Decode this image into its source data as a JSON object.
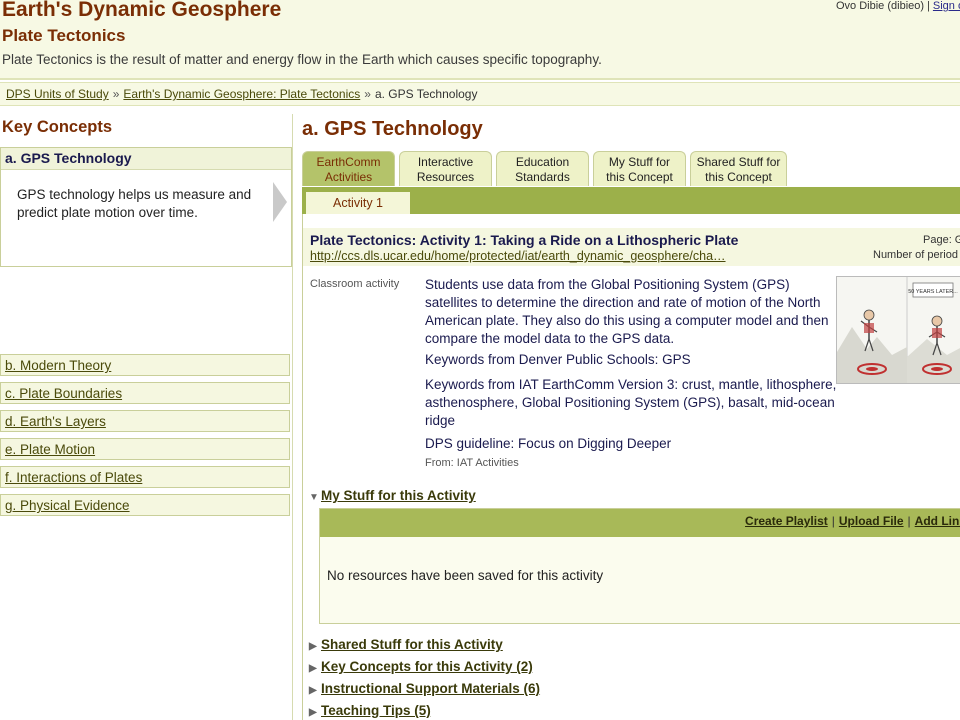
{
  "header": {
    "title": "Earth's Dynamic Geosphere",
    "subtitle": "Plate Tectonics",
    "description": "Plate Tectonics is the result of matter and energy flow in the Earth which causes specific topography.",
    "user": "Ovo Dibie (dibieo)",
    "signout": "Sign o"
  },
  "breadcrumb": {
    "items": [
      "DPS Units of Study",
      "Earth's Dynamic Geosphere: Plate Tectonics"
    ],
    "current": "a. GPS Technology",
    "separator": "»"
  },
  "sidebar": {
    "title": "Key Concepts",
    "active": {
      "label": "a. GPS Technology",
      "description": "GPS technology helps us measure and predict plate motion over time."
    },
    "items": [
      "b. Modern Theory",
      "c. Plate Boundaries",
      "d. Earth's Layers",
      "e. Plate Motion",
      "f. Interactions of Plates",
      "g. Physical Evidence"
    ]
  },
  "main": {
    "title": "a. GPS Technology",
    "tabs": [
      {
        "line1": "EarthComm",
        "line2": "Activities"
      },
      {
        "line1": "Interactive",
        "line2": "Resources"
      },
      {
        "line1": "Education",
        "line2": "Standards"
      },
      {
        "line1": "My Stuff for",
        "line2": "this Concept"
      },
      {
        "line1": "Shared Stuff for",
        "line2": "this Concept"
      }
    ],
    "subtab": "Activity 1",
    "resource": {
      "title": "Plate Tectonics: Activity 1: Taking a Ride on a Lithospheric Plate",
      "url": "http://ccs.dls.ucar.edu/home/protected/iat/earth_dynamic_geosphere/cha…",
      "page_label": "Page: G",
      "periods_label": "Number of period",
      "type": "Classroom activity",
      "description": "Students use data from the Global Positioning System (GPS) satellites to determine the direction and rate of motion of the North American plate. They also do this using a computer model and then compare the model data to the GPS data.",
      "keywords_dps": "Keywords from Denver Public Schools: GPS",
      "keywords_iat": "Keywords from IAT EarthComm Version 3: crust, mantle, lithosphere, asthenosphere, Global Positioning System (GPS), basalt, mid-ocean ridge",
      "guideline": "DPS guideline: Focus on Digging Deeper",
      "from": "From: IAT Activities",
      "thumb_text": "50 YEARS LATER..."
    },
    "my_stuff": {
      "label": "My Stuff for this Activity",
      "links": [
        "Create Playlist",
        "Upload File",
        "Add Link"
      ],
      "link_sep": "|",
      "empty": "No resources have been saved for this activity"
    },
    "sections": [
      "Shared Stuff for this Activity",
      "Key Concepts for this Activity (2)",
      "Instructional Support Materials (6)",
      "Teaching Tips (5)"
    ]
  },
  "colors": {
    "title_brown": "#7a2e05",
    "header_bg": "#f7f9e4",
    "tab_active": "#b4c36a",
    "strip_green": "#9cb04a",
    "navy_text": "#1a1a4e"
  }
}
